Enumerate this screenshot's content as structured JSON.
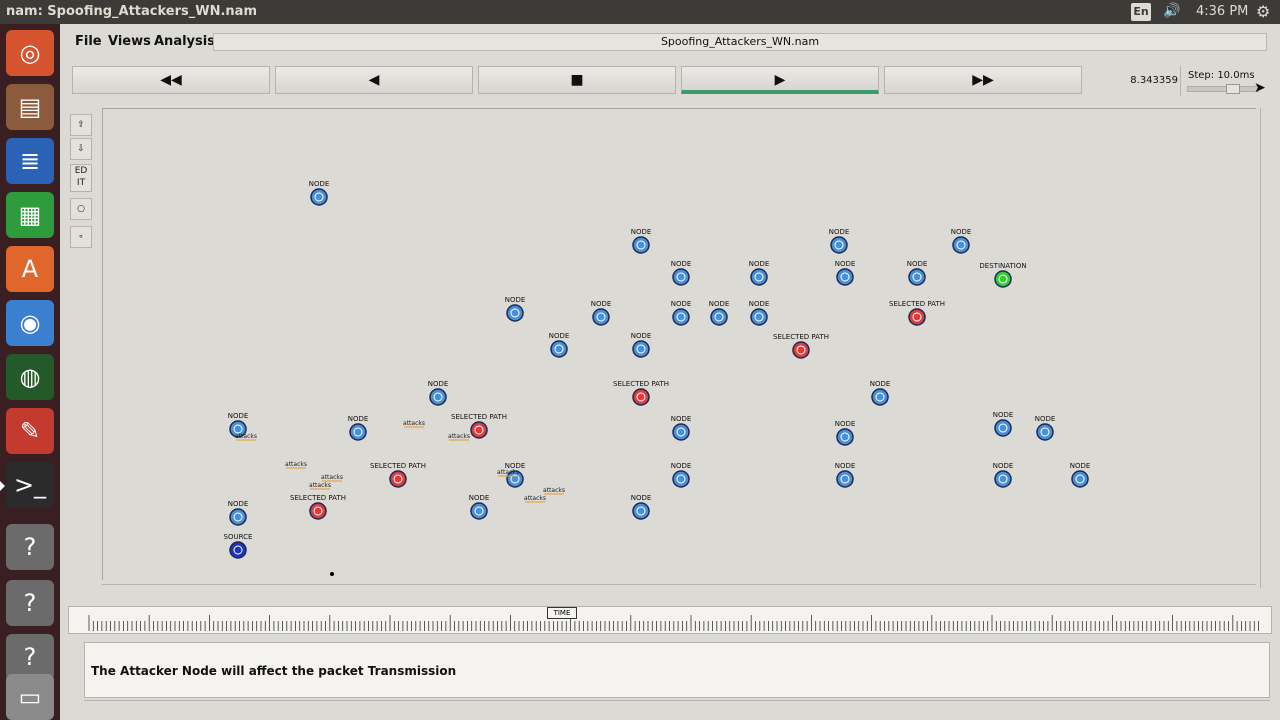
{
  "panel": {
    "window_title": "nam: Spoofing_Attackers_WN.nam",
    "keyboard": "En",
    "clock": "4:36 PM"
  },
  "menus": {
    "file": "File",
    "views": "Views",
    "analysis": "Analysis"
  },
  "file_title": "Spoofing_Attackers_WN.nam",
  "controls": {
    "rewind": "◀◀",
    "back": "◀",
    "stop": "■",
    "play": "▶",
    "fast_forward": "▶▶",
    "time": "8.343359",
    "step": "Step: 10.0ms",
    "step_level": 0.65
  },
  "tools": {
    "edit": "ED IT"
  },
  "annotation": "The Attacker Node will affect the packet Transmission",
  "timeline_marker": "TIME",
  "colors": {
    "node_blue": "#4a90d9",
    "node_selected": "#e03c3c",
    "node_destination": "#33cc33",
    "node_source": "#2233bb"
  },
  "network": {
    "node_label": "NODE",
    "nodes": [
      {
        "label": "NODE",
        "type": "node"
      },
      {
        "label": "NODE",
        "type": "node"
      },
      {
        "label": "NODE",
        "type": "node"
      },
      {
        "label": "NODE",
        "type": "node"
      },
      {
        "label": "NODE",
        "type": "node"
      },
      {
        "label": "NODE",
        "type": "node"
      },
      {
        "label": "NODE",
        "type": "node"
      },
      {
        "label": "NODE",
        "type": "node"
      },
      {
        "label": "NODE",
        "type": "node"
      },
      {
        "label": "DESTINATION",
        "type": "destination"
      },
      {
        "label": "NODE",
        "type": "node"
      },
      {
        "label": "NODE",
        "type": "node"
      },
      {
        "label": "NODE",
        "type": "node"
      },
      {
        "label": "NODE",
        "type": "node"
      },
      {
        "label": "NODE",
        "type": "node"
      },
      {
        "label": "SELECTED PATH",
        "type": "selected"
      },
      {
        "label": "NODE",
        "type": "node"
      },
      {
        "label": "SELECTED PATH",
        "type": "selected"
      },
      {
        "label": "NODE",
        "type": "node"
      },
      {
        "label": "SELECTED PATH",
        "type": "selected"
      },
      {
        "label": "NODE",
        "type": "node"
      },
      {
        "label": "NODE",
        "type": "node"
      },
      {
        "label": "NODE",
        "type": "node"
      },
      {
        "label": "SELECTED PATH",
        "type": "selected"
      },
      {
        "label": "NODE",
        "type": "node"
      },
      {
        "label": "NODE",
        "type": "node"
      },
      {
        "label": "NODE",
        "type": "node"
      },
      {
        "label": "NODE",
        "type": "node"
      },
      {
        "label": "NODE",
        "type": "node"
      },
      {
        "label": "SELECTED PATH",
        "type": "selected"
      },
      {
        "label": "NODE",
        "type": "node"
      },
      {
        "label": "NODE",
        "type": "node"
      },
      {
        "label": "NODE",
        "type": "node"
      },
      {
        "label": "NODE",
        "type": "node"
      },
      {
        "label": "NODE",
        "type": "node"
      },
      {
        "label": "NODE",
        "type": "node"
      },
      {
        "label": "SELECTED PATH",
        "type": "selected"
      },
      {
        "label": "NODE",
        "type": "node"
      },
      {
        "label": "NODE",
        "type": "node"
      },
      {
        "label": "NODE",
        "type": "node"
      },
      {
        "label": "SOURCE",
        "type": "source"
      }
    ],
    "attack_labels": [
      "attacks",
      "attacks",
      "attacks",
      "attacks",
      "attacks",
      "attacks",
      "attacks",
      "attacks",
      "attacks"
    ]
  }
}
